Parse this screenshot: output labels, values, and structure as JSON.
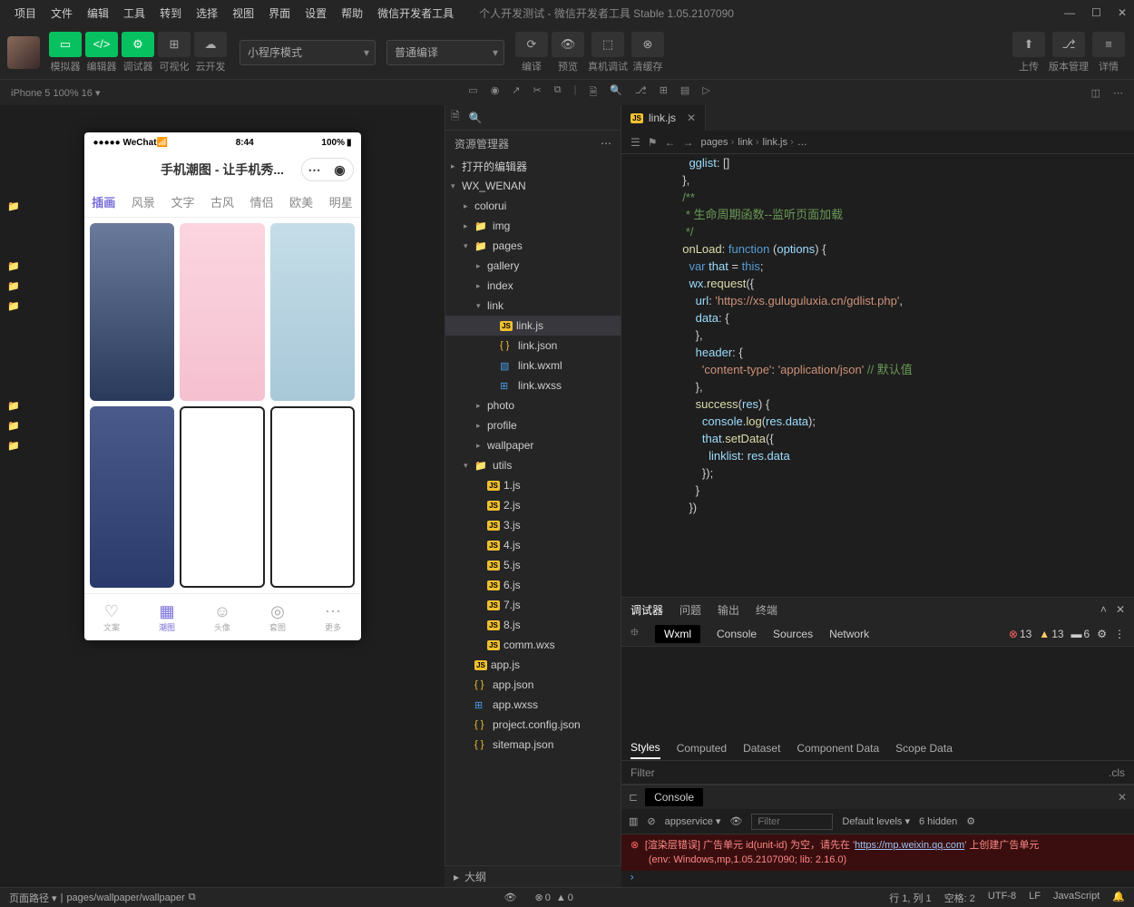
{
  "menu": [
    "项目",
    "文件",
    "编辑",
    "工具",
    "转到",
    "选择",
    "视图",
    "界面",
    "设置",
    "帮助",
    "微信开发者工具"
  ],
  "window_title": "个人开发测试 - 微信开发者工具 Stable 1.05.2107090",
  "toolbar": {
    "simulator": "模拟器",
    "editor": "编辑器",
    "debugger": "调试器",
    "visualize": "可视化",
    "cloud": "云开发",
    "mode": "小程序模式",
    "compile_mode": "普通编译",
    "compile": "编译",
    "preview": "预览",
    "remote": "真机调试",
    "cache": "清缓存",
    "upload": "上传",
    "version": "版本管理",
    "detail": "详情"
  },
  "device": {
    "name": "iPhone 5 100% 16"
  },
  "simulator": {
    "status_left": "●●●●● WeChat",
    "status_wifi": "⚡",
    "time": "8:44",
    "battery": "100%",
    "page_title": "手机潮图 - 让手机秀...",
    "tabs": [
      "插画",
      "风景",
      "文字",
      "古风",
      "情侣",
      "欧美",
      "明星"
    ],
    "nav": [
      {
        "icon": "♡",
        "label": "文案"
      },
      {
        "icon": "▦",
        "label": "潮图"
      },
      {
        "icon": "☺",
        "label": "头像"
      },
      {
        "icon": "◎",
        "label": "套图"
      },
      {
        "icon": "⋯",
        "label": "更多"
      }
    ]
  },
  "explorer": {
    "title": "资源管理器",
    "sections": [
      "打开的编辑器",
      "WX_WENAN"
    ],
    "tree": [
      {
        "d": 1,
        "t": "folder",
        "n": "colorui",
        "e": false
      },
      {
        "d": 1,
        "t": "folder-g",
        "n": "img",
        "e": false
      },
      {
        "d": 1,
        "t": "folder-g",
        "n": "pages",
        "e": true
      },
      {
        "d": 2,
        "t": "folder",
        "n": "gallery",
        "e": false
      },
      {
        "d": 2,
        "t": "folder",
        "n": "index",
        "e": false
      },
      {
        "d": 2,
        "t": "folder",
        "n": "link",
        "e": true
      },
      {
        "d": 3,
        "t": "js",
        "n": "link.js",
        "sel": true
      },
      {
        "d": 3,
        "t": "json",
        "n": "link.json"
      },
      {
        "d": 3,
        "t": "wxml",
        "n": "link.wxml"
      },
      {
        "d": 3,
        "t": "wxss",
        "n": "link.wxss"
      },
      {
        "d": 2,
        "t": "folder",
        "n": "photo",
        "e": false
      },
      {
        "d": 2,
        "t": "folder",
        "n": "profile",
        "e": false
      },
      {
        "d": 2,
        "t": "folder",
        "n": "wallpaper",
        "e": false
      },
      {
        "d": 1,
        "t": "folder-g",
        "n": "utils",
        "e": true
      },
      {
        "d": 2,
        "t": "js",
        "n": "1.js"
      },
      {
        "d": 2,
        "t": "js",
        "n": "2.js"
      },
      {
        "d": 2,
        "t": "js",
        "n": "3.js"
      },
      {
        "d": 2,
        "t": "js",
        "n": "4.js"
      },
      {
        "d": 2,
        "t": "js",
        "n": "5.js"
      },
      {
        "d": 2,
        "t": "js",
        "n": "6.js"
      },
      {
        "d": 2,
        "t": "js",
        "n": "7.js"
      },
      {
        "d": 2,
        "t": "js",
        "n": "8.js"
      },
      {
        "d": 2,
        "t": "js",
        "n": "comm.wxs"
      },
      {
        "d": 1,
        "t": "js",
        "n": "app.js"
      },
      {
        "d": 1,
        "t": "json",
        "n": "app.json"
      },
      {
        "d": 1,
        "t": "wxss",
        "n": "app.wxss"
      },
      {
        "d": 1,
        "t": "json",
        "n": "project.config.json"
      },
      {
        "d": 1,
        "t": "json",
        "n": "sitemap.json"
      }
    ],
    "outline": "大纲"
  },
  "editor": {
    "tab": "link.js",
    "breadcrumb": [
      "pages",
      "link",
      "link.js",
      "…"
    ],
    "code_lines": [
      "    gglist: []",
      "  },",
      "",
      "  /**",
      "   * 生命周期函数--监听页面加载",
      "   */",
      "  onLoad: function (options) {",
      "    var that = this;",
      "    wx.request({",
      "      url: 'https://xs.guluguluxia.cn/gdlist.php',",
      "      data: {",
      "      },",
      "      header: {",
      "        'content-type': 'application/json' // 默认值",
      "      },",
      "      success(res) {",
      "        console.log(res.data);",
      "        that.setData({",
      "          linklist: res.data",
      "        });",
      "      }",
      "    })"
    ]
  },
  "devtools": {
    "top_tabs": [
      "调试器",
      "问题",
      "输出",
      "终端"
    ],
    "panels": [
      "Wxml",
      "Console",
      "Sources",
      "Network"
    ],
    "badges": {
      "err": "13",
      "warn": "13",
      "info": "6"
    },
    "sub_tabs": [
      "Styles",
      "Computed",
      "Dataset",
      "Component Data",
      "Scope Data"
    ],
    "filter_placeholder": "Filter",
    "cls": ".cls"
  },
  "console": {
    "tab": "Console",
    "context": "appservice",
    "filter": "Filter",
    "levels": "Default levels",
    "hidden": "6 hidden",
    "error_pre": "[渲染层错误] 广告单元 id(unit-id) 为空，请先在 '",
    "error_url": "https://mp.weixin.qq.com",
    "error_post": "' 上创建广告单元",
    "env": "(env: Windows,mp,1.05.2107090; lib: 2.16.0)"
  },
  "status": {
    "path_label": "页面路径",
    "path": "pages/wallpaper/wallpaper",
    "err": "0",
    "warn": "0",
    "pos": "行 1, 列 1",
    "spaces": "空格: 2",
    "enc": "UTF-8",
    "eol": "LF",
    "lang": "JavaScript"
  }
}
